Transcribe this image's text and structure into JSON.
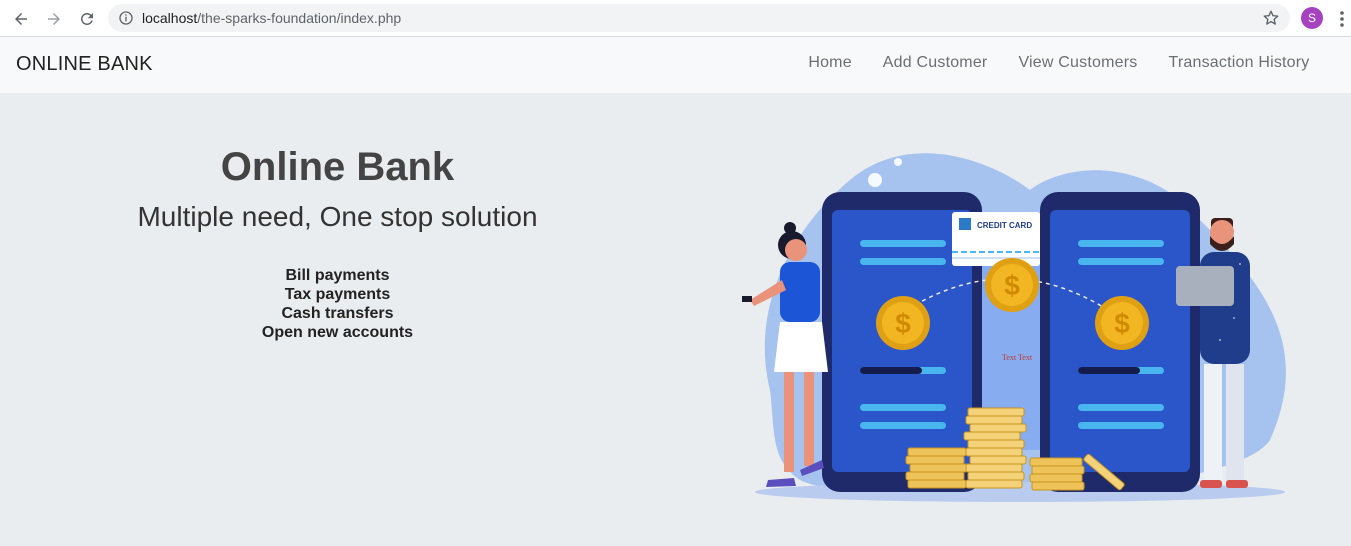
{
  "browser": {
    "url_host": "localhost",
    "url_path": "/the-sparks-foundation/index.php",
    "profile_initial": "S",
    "icons": [
      "back-arrow-icon",
      "forward-arrow-icon",
      "reload-icon",
      "info-icon",
      "star-icon",
      "more-vert-icon"
    ]
  },
  "navbar": {
    "brand": "ONLINE BANK",
    "links": [
      "Home",
      "Add Customer",
      "View Customers",
      "Transaction History"
    ]
  },
  "hero": {
    "title": "Online Bank",
    "subtitle": "Multiple need, One stop solution",
    "features": [
      "Bill payments",
      "Tax payments",
      "Cash transfers",
      "Open new accounts"
    ]
  },
  "illustration": {
    "card_label": "CREDIT CARD",
    "coin_symbol": "$",
    "placeholder_text": "Text Text"
  },
  "colors": {
    "phone_dark": "#1f2a6b",
    "phone_screen": "#2b56c9",
    "coin_gold": "#f2b623",
    "blob_blue": "#8fb3ef",
    "avatar_purple": "#a642bf"
  }
}
